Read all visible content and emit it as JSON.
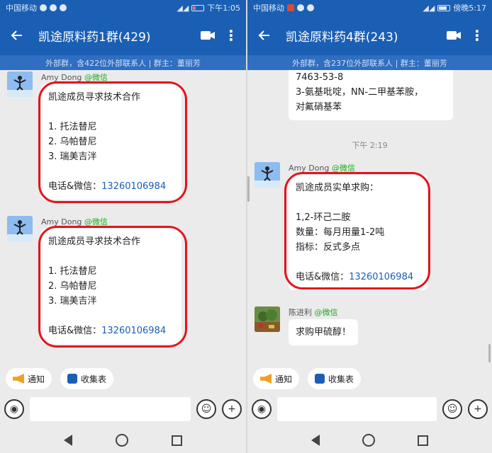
{
  "left": {
    "status": {
      "carrier": "中国移动",
      "time": "下午1:05",
      "battery_level": 0.3
    },
    "appbar": {
      "title": "凯途原料药1群(429)"
    },
    "subbar": {
      "info": "外部群，含422位外部联系人 | 群主：董丽芳"
    },
    "messages": [
      {
        "sender_name": "Amy Dong",
        "sender_suffix": "@微信",
        "lines": [
          "凯途成员寻求技术合作",
          "",
          "1. 托法替尼",
          "2. 乌帕替尼",
          "3. 瑞美吉泮",
          "",
          "电话&微信："
        ],
        "phone": "13260106984"
      },
      {
        "sender_name": "Amy Dong",
        "sender_suffix": "@微信",
        "lines": [
          "凯途成员寻求技术合作",
          "",
          "1. 托法替尼",
          "2. 乌帕替尼",
          "3. 瑞美吉泮",
          "",
          "电话&微信："
        ],
        "phone": "13260106984"
      }
    ],
    "quick": {
      "notice": "通知",
      "form": "收集表"
    }
  },
  "right": {
    "status": {
      "carrier": "中国移动",
      "time": "傍晚5:17",
      "battery_level": 0.8
    },
    "appbar": {
      "title": "凯途原料药4群(243)"
    },
    "subbar": {
      "info": "外部群，含237位外部联系人 | 群主：董丽芳"
    },
    "partial_message": {
      "lines": [
        "7463-53-8",
        "3-氨基吡啶，NN-二甲基苯胺，",
        "对氟硝基苯"
      ]
    },
    "timestamp": "下午 2:19",
    "messages": [
      {
        "sender_name": "Amy Dong",
        "sender_suffix": "@微信",
        "lines": [
          "凯途成员实单求购：",
          "",
          "1,2-环己二胺",
          "数量：每月用量1-2吨",
          "指标：反式多点",
          "",
          "电话&微信："
        ],
        "phone": "13260106984"
      },
      {
        "sender_name": "陈进利",
        "sender_suffix": "@微信",
        "lines": [
          "求购甲硫醇！"
        ]
      }
    ],
    "quick": {
      "notice": "通知",
      "form": "收集表"
    }
  },
  "colors": {
    "brand": "#1a5fb4",
    "highlight_ring": "#e3141f",
    "wechat_green": "#1aad19",
    "phone_link": "#1a5fb4"
  }
}
